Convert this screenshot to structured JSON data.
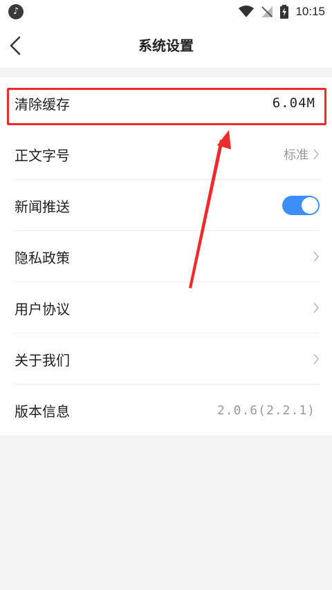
{
  "status_bar": {
    "time": "10:15",
    "app_icon": "music-note-icon",
    "icons": [
      "wifi-icon",
      "no-signal-icon",
      "battery-charging-icon"
    ]
  },
  "nav": {
    "title": "系统设置",
    "back_icon": "chevron-left-icon"
  },
  "settings": {
    "clear_cache": {
      "label": "清除缓存",
      "value": "6.04M"
    },
    "font_size": {
      "label": "正文字号",
      "value": "标准"
    },
    "news_push": {
      "label": "新闻推送",
      "enabled": true
    },
    "privacy": {
      "label": "隐私政策"
    },
    "user_agreement": {
      "label": "用户协议"
    },
    "about_us": {
      "label": "关于我们"
    },
    "version": {
      "label": "版本信息",
      "value": "2.0.6(2.2.1)"
    }
  },
  "colors": {
    "accent": "#3d8ef7",
    "highlight": "#ee2a2a",
    "background": "#f4f4f4"
  }
}
